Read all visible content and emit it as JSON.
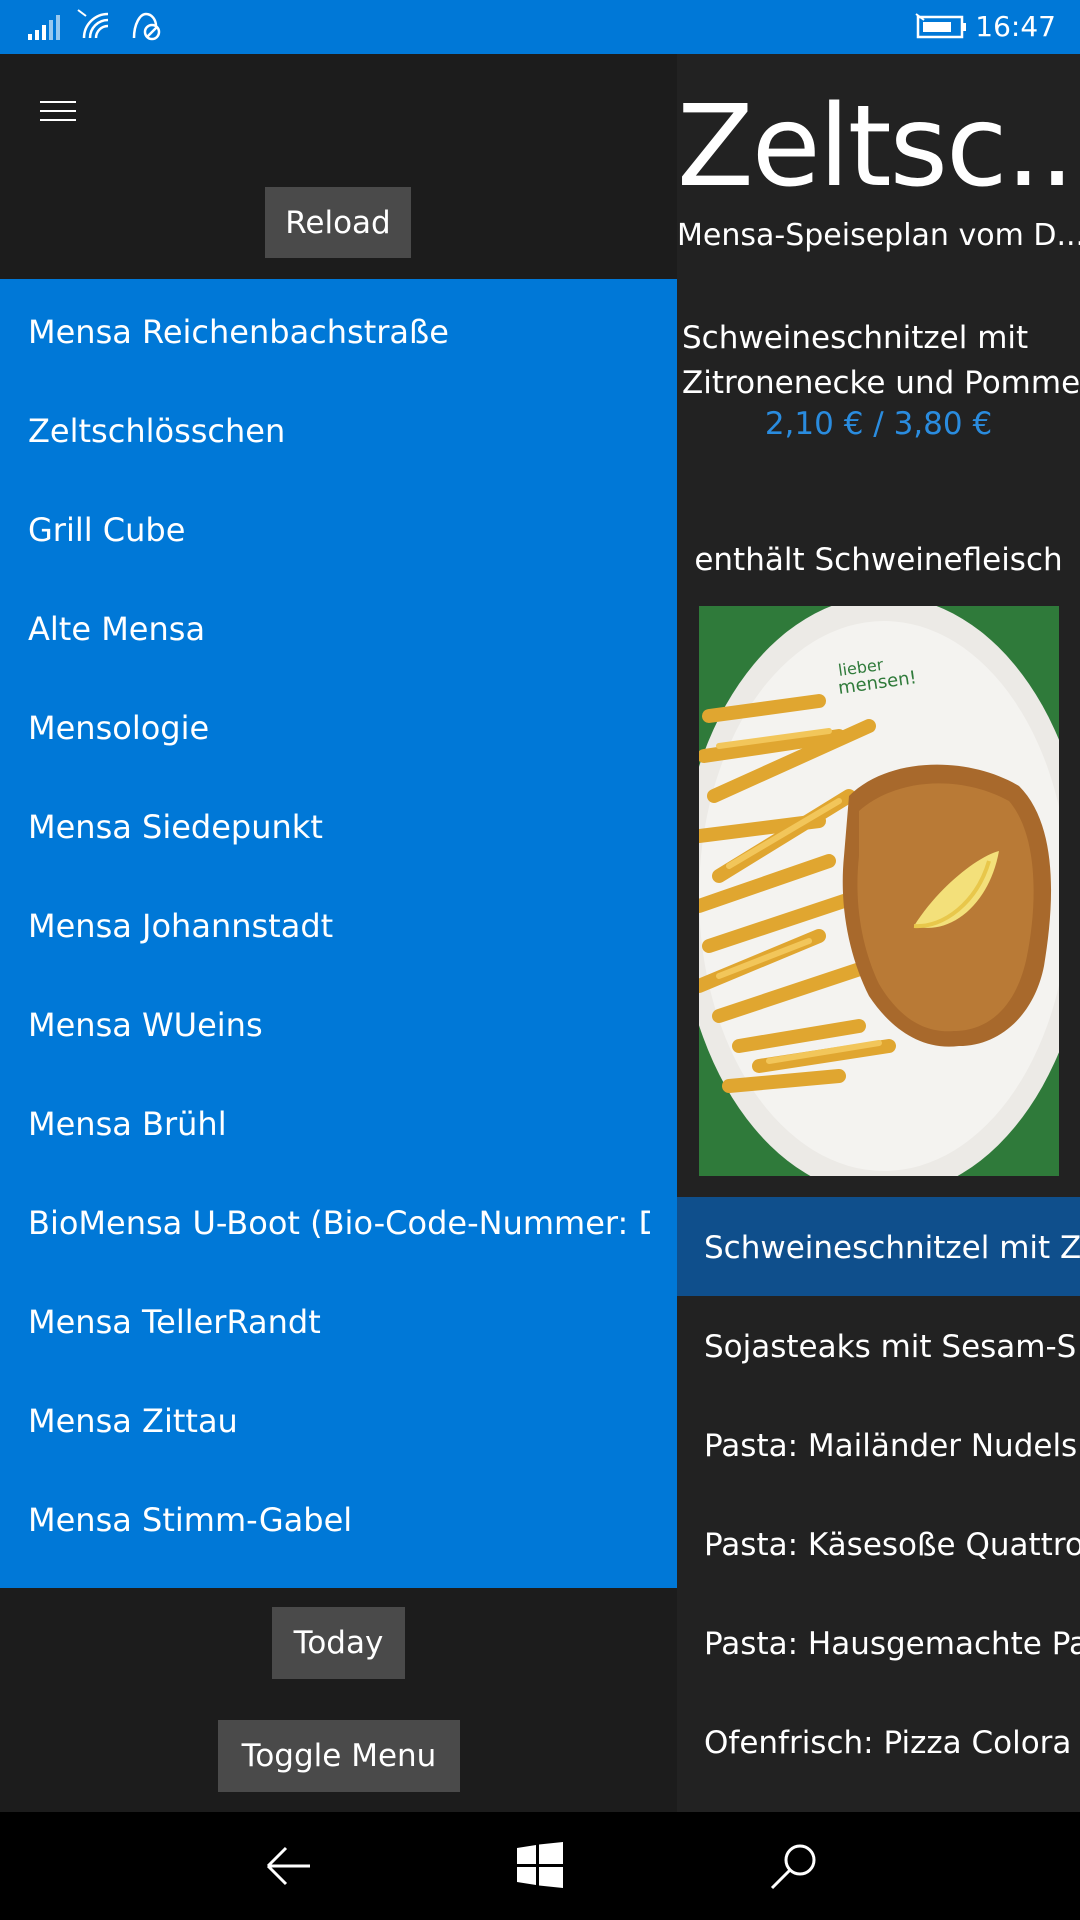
{
  "status_bar": {
    "time": "16:47",
    "icons": [
      "signal-icon",
      "wifi-icon",
      "location-off-icon",
      "battery-charging-icon"
    ],
    "background": "#0078d7"
  },
  "left_pane": {
    "reload_label": "Reload",
    "mensa_items": [
      "Mensa Reichenbachstraße",
      "Zeltschlösschen",
      "Grill Cube",
      "Alte Mensa",
      "Mensologie",
      "Mensa Siedepunkt",
      "Mensa Johannstadt",
      "Mensa WUeins",
      "Mensa Brühl",
      "BioMensa U-Boot (Bio-Code-Nummer: DE",
      "Mensa TellerRandt",
      "Mensa Zittau",
      "Mensa Stimm-Gabel"
    ],
    "today_label": "Today",
    "toggle_menu_label": "Toggle Menu",
    "accent": "#0078d7"
  },
  "right_pane": {
    "title": "Zeltsc...",
    "subtitle": "Mensa-Speiseplan vom D...",
    "dish_line1": "Schweineschnitzel mit",
    "dish_line2": "Zitronenecke und Pommes",
    "price": "2,10 € / 3,80 €",
    "note": "enthält Schweinefleisch",
    "meals": [
      "Schweineschnitzel mit Z",
      "Sojasteaks mit Sesam-S",
      "Pasta: Mailänder Nudels",
      "Pasta: Käsesoße Quattro",
      "Pasta: Hausgemachte Pa",
      "Ofenfrisch: Pizza Colora"
    ],
    "price_color": "#2a8cdf",
    "selected_color": "#0f4f8c"
  },
  "nav_bar": {
    "icons": [
      "back-arrow-icon",
      "windows-start-icon",
      "search-icon"
    ]
  }
}
